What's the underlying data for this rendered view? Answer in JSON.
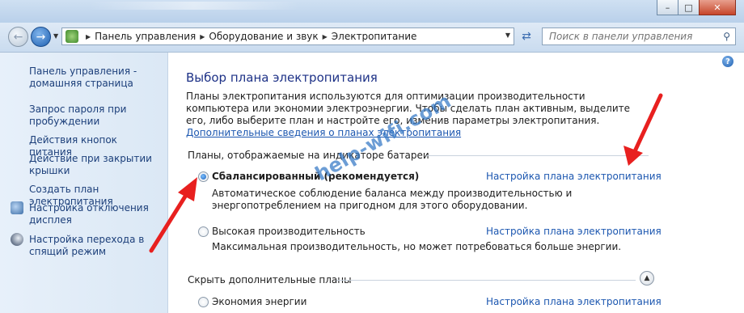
{
  "window": {
    "minimize_icon": "minimize-icon",
    "maximize_icon": "maximize-icon",
    "close_icon": "close-icon"
  },
  "nav": {
    "breadcrumbs": [
      "Панель управления",
      "Оборудование и звук",
      "Электропитание"
    ],
    "search_placeholder": "Поиск в панели управления"
  },
  "sidebar": {
    "items": [
      {
        "label": "Панель управления - домашняя страница"
      },
      {
        "label": "Запрос пароля при пробуждении"
      },
      {
        "label": "Действия кнопок питания"
      },
      {
        "label": "Действие при закрытии крышки"
      },
      {
        "label": "Создать план электропитания"
      },
      {
        "label": "Настройка отключения дисплея",
        "icon": "display-clock-icon"
      },
      {
        "label": "Настройка перехода в спящий режим",
        "icon": "moon-icon"
      }
    ]
  },
  "main": {
    "title": "Выбор плана электропитания",
    "intro": "Планы электропитания используются для оптимизации производительности компьютера или экономии электроэнергии. Чтобы сделать план активным, выделите его, либо выберите план и настройте его, изменив параметры электропитания.",
    "intro_link": "Дополнительные сведения о планах электропитания",
    "group_battery": "Планы, отображаемые на индикаторе батареи",
    "group_hidden": "Скрыть дополнительные планы",
    "plans": [
      {
        "name": "Сбалансированный (рекомендуется)",
        "selected": true,
        "link": "Настройка плана электропитания",
        "description": "Автоматическое соблюдение баланса между производительностью и энергопотреблением на пригодном для этого оборудовании."
      },
      {
        "name": "Высокая производительность",
        "selected": false,
        "link": "Настройка плана электропитания",
        "description": "Максимальная производительность, но может потребоваться больше энергии."
      },
      {
        "name": "Экономия энергии",
        "selected": false,
        "link": "Настройка плана электропитания"
      }
    ]
  },
  "watermark": "help-wifi.com",
  "colors": {
    "link": "#1c57b0",
    "title": "#1e3287",
    "arrow": "#e8201f"
  }
}
